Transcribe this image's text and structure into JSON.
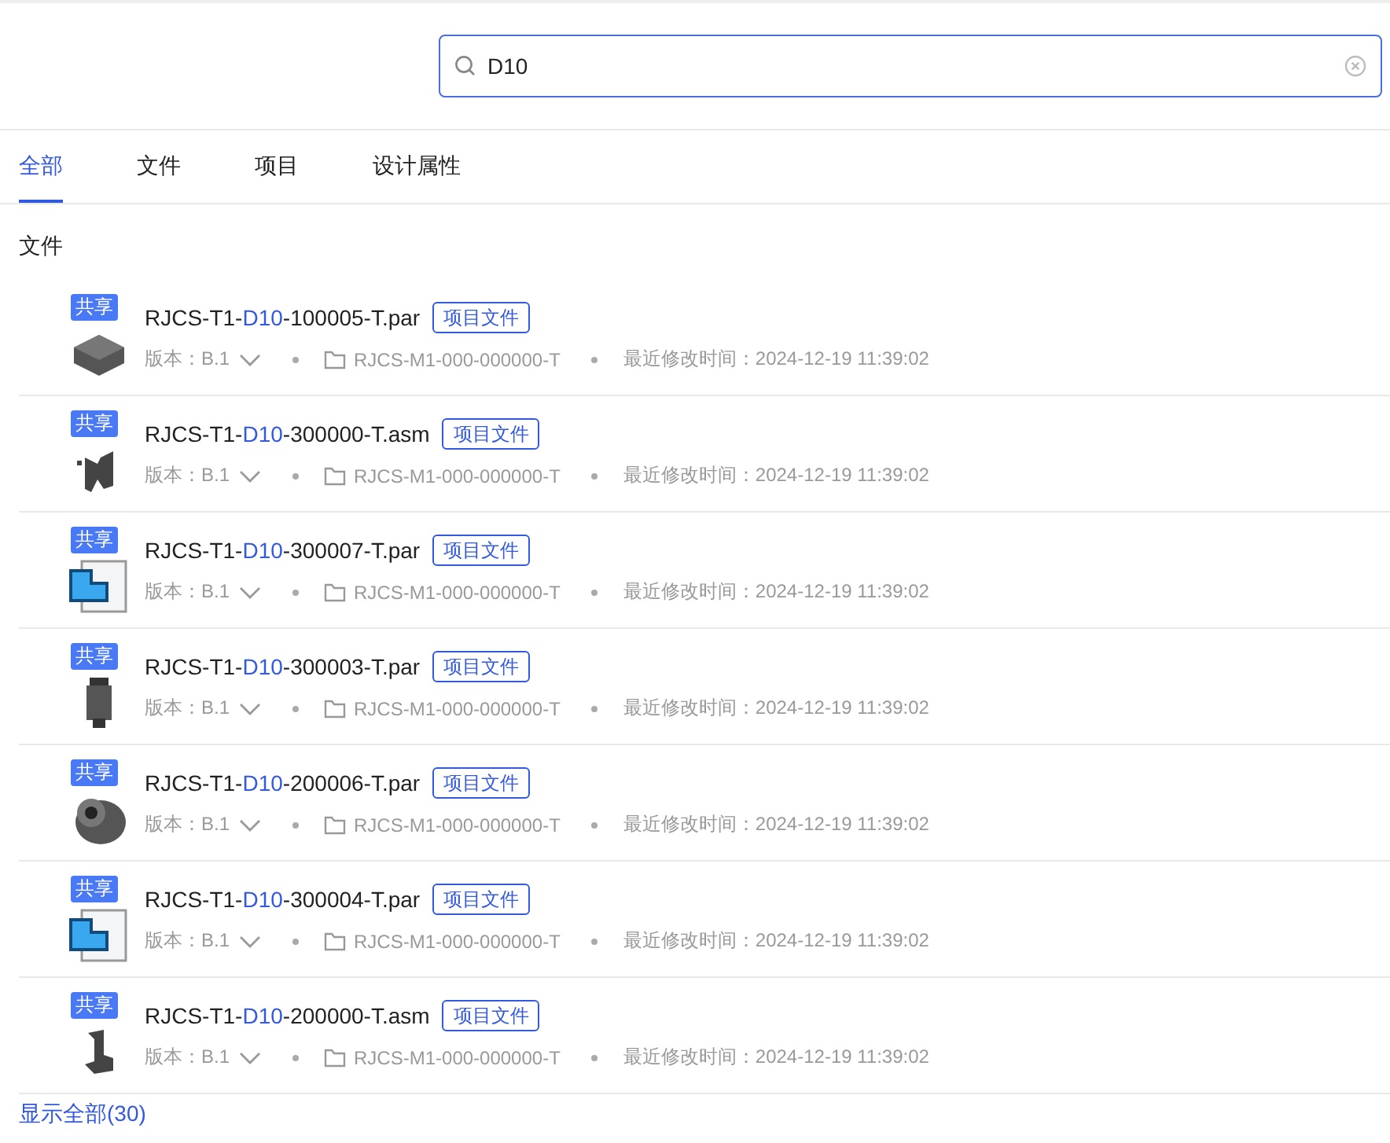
{
  "search": {
    "value": "D10"
  },
  "tabs": [
    {
      "label": "全部",
      "selected": true
    },
    {
      "label": "文件",
      "selected": false
    },
    {
      "label": "项目",
      "selected": false
    },
    {
      "label": "设计属性",
      "selected": false
    }
  ],
  "section_title": "文件",
  "files": [
    {
      "kind": "box",
      "badge": "共享",
      "name_before": "RJCS-T1-",
      "name_match": "D10",
      "name_after": "-100005-T.par",
      "tag": "项目文件",
      "version": "版本：B.1",
      "folder": "RJCS-M1-000-000000-T",
      "modified": "最近修改时间：2024-12-19 11:39:02"
    },
    {
      "kind": "bracket",
      "badge": "共享",
      "name_before": "RJCS-T1-",
      "name_match": "D10",
      "name_after": "-300000-T.asm",
      "tag": "项目文件",
      "version": "版本：B.1",
      "folder": "RJCS-M1-000-000000-T",
      "modified": "最近修改时间：2024-12-19 11:39:02"
    },
    {
      "kind": "sheet",
      "badge": "共享",
      "name_before": "RJCS-T1-",
      "name_match": "D10",
      "name_after": "-300007-T.par",
      "tag": "项目文件",
      "version": "版本：B.1",
      "folder": "RJCS-M1-000-000000-T",
      "modified": "最近修改时间：2024-12-19 11:39:02"
    },
    {
      "kind": "pin",
      "badge": "共享",
      "name_before": "RJCS-T1-",
      "name_match": "D10",
      "name_after": "-300003-T.par",
      "tag": "项目文件",
      "version": "版本：B.1",
      "folder": "RJCS-M1-000-000000-T",
      "modified": "最近修改时间：2024-12-19 11:39:02"
    },
    {
      "kind": "ring",
      "badge": "共享",
      "name_before": "RJCS-T1-",
      "name_match": "D10",
      "name_after": "-200006-T.par",
      "tag": "项目文件",
      "version": "版本：B.1",
      "folder": "RJCS-M1-000-000000-T",
      "modified": "最近修改时间：2024-12-19 11:39:02"
    },
    {
      "kind": "sheet",
      "badge": "共享",
      "name_before": "RJCS-T1-",
      "name_match": "D10",
      "name_after": "-300004-T.par",
      "tag": "项目文件",
      "version": "版本：B.1",
      "folder": "RJCS-M1-000-000000-T",
      "modified": "最近修改时间：2024-12-19 11:39:02"
    },
    {
      "kind": "clip",
      "badge": "共享",
      "name_before": "RJCS-T1-",
      "name_match": "D10",
      "name_after": "-200000-T.asm",
      "tag": "项目文件",
      "version": "版本：B.1",
      "folder": "RJCS-M1-000-000000-T",
      "modified": "最近修改时间：2024-12-19 11:39:02"
    }
  ],
  "show_all": "显示全部(30)"
}
